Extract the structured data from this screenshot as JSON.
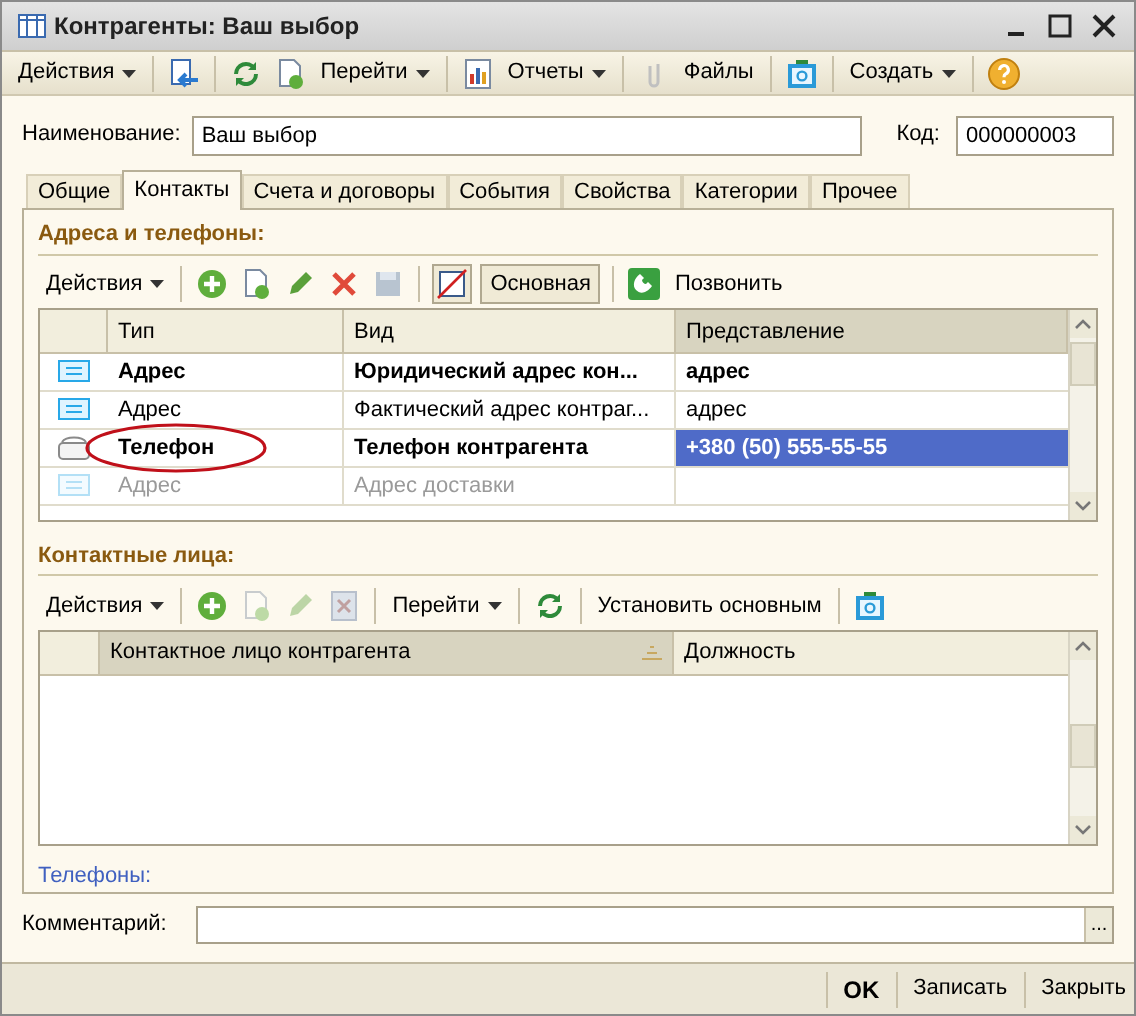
{
  "window": {
    "title": "Контрагенты: Ваш выбор"
  },
  "toolbar": {
    "actions": "Действия",
    "goto": "Перейти",
    "reports": "Отчеты",
    "files": "Файлы",
    "create": "Создать"
  },
  "name_field": {
    "label": "Наименование:",
    "value": "Ваш выбор"
  },
  "code_field": {
    "label": "Код:",
    "value": "000000003"
  },
  "tabs": [
    {
      "label": "Общие",
      "selected": false
    },
    {
      "label": "Контакты",
      "selected": true
    },
    {
      "label": "Счета и договоры",
      "selected": false
    },
    {
      "label": "События",
      "selected": false
    },
    {
      "label": "Свойства",
      "selected": false
    },
    {
      "label": "Категории",
      "selected": false
    },
    {
      "label": "Прочее",
      "selected": false
    }
  ],
  "addresses": {
    "heading": "Адреса и телефоны:",
    "toolbar": {
      "actions": "Действия",
      "main": "Основная",
      "call": "Позвонить"
    },
    "columns": [
      "Тип",
      "Вид",
      "Представление"
    ],
    "rows": [
      {
        "kind": "address",
        "type": "Адрес",
        "view": "Юридический адрес кон...",
        "value": "адрес",
        "bold": true,
        "dimmed": false,
        "circled": false,
        "selected": false
      },
      {
        "kind": "address",
        "type": "Адрес",
        "view": "Фактический адрес контраг...",
        "value": "адрес",
        "bold": false,
        "dimmed": false,
        "circled": false,
        "selected": false
      },
      {
        "kind": "phone",
        "type": "Телефон",
        "view": "Телефон контрагента",
        "value": "+380 (50) 555-55-55",
        "bold": true,
        "dimmed": false,
        "circled": true,
        "selected": true
      },
      {
        "kind": "address",
        "type": "Адрес",
        "view": "Адрес доставки",
        "bold": false,
        "dimmed": true,
        "circled": false,
        "selected": false
      }
    ]
  },
  "contacts": {
    "heading": "Контактные лица:",
    "toolbar": {
      "actions": "Действия",
      "goto": "Перейти",
      "set_main": "Установить основным"
    },
    "columns": [
      "Контактное лицо контрагента",
      "Должность"
    ]
  },
  "phones_link": "Телефоны:",
  "comment_field": {
    "label": "Комментарий:",
    "button": "..."
  },
  "footer": {
    "ok": "OK",
    "save": "Записать",
    "close": "Закрыть"
  }
}
